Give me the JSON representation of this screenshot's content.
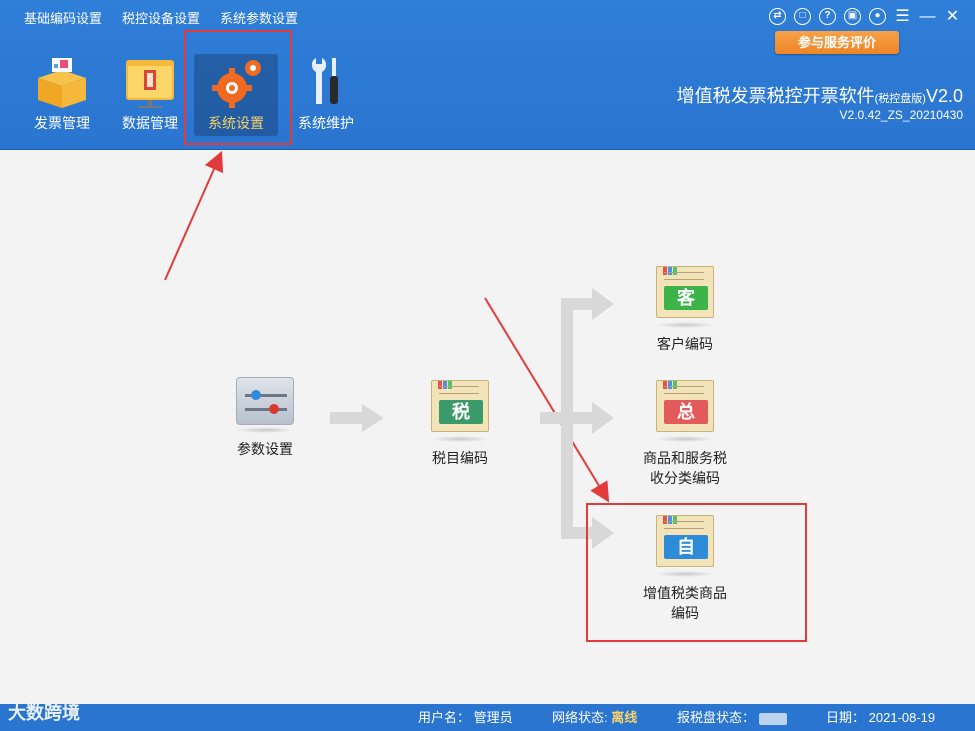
{
  "menu": [
    "基础编码设置",
    "税控设备设置",
    "系统参数设置"
  ],
  "eval_button": "参与服务评价",
  "toolbar": {
    "invoice": "发票管理",
    "data": "数据管理",
    "settings": "系统设置",
    "maintenance": "系统维护"
  },
  "app": {
    "title": "增值税发票税控开票软件",
    "edition": "(税控盘版)",
    "version_suffix": "V2.0",
    "build": "V2.0.42_ZS_20210430"
  },
  "flow": {
    "param": "参数设置",
    "tax_code": "税目编码",
    "customer": {
      "label": "客户编码",
      "tag": "客"
    },
    "goods_l1": "商品和服务税",
    "goods_l2": "收分类编码",
    "goods_tag": "总",
    "vat_l1": "增值税类商品",
    "vat_l2": "编码",
    "vat_tag": "自",
    "tax_tag": "税"
  },
  "status": {
    "user_label": "用户名：",
    "user": "管理员",
    "net_label": "网络状态:",
    "net": "离线",
    "disk_label": "报税盘状态：",
    "date_label": "日期：",
    "date": "2021-08-19",
    "watermark": "大数跨境"
  },
  "colors": {
    "header": "#2f7ed8",
    "highlight": "#e23b3b",
    "accent": "#ee8526"
  }
}
